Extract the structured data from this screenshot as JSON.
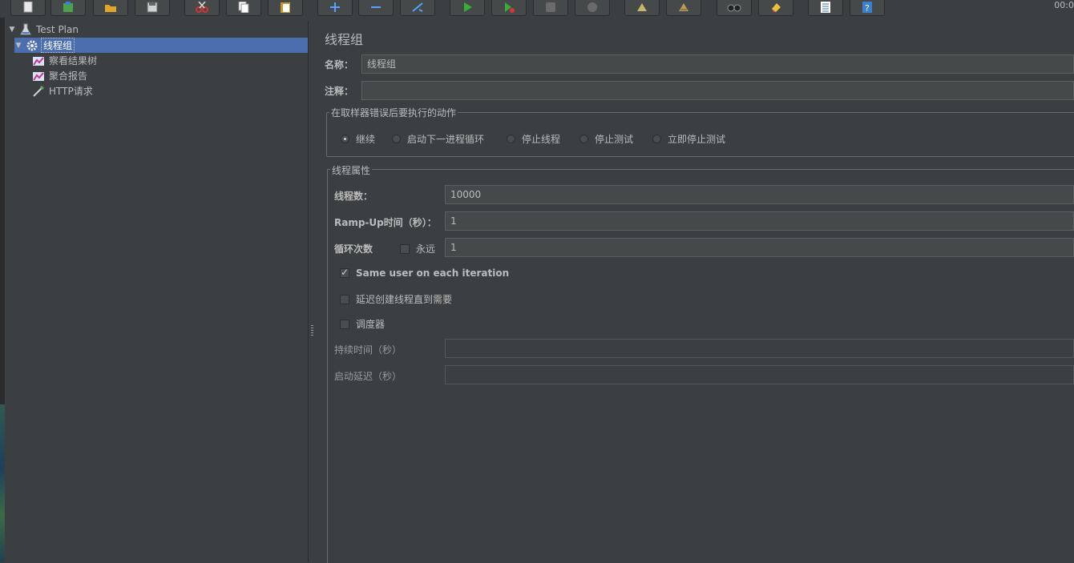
{
  "toolbar": {
    "clock": "00:0",
    "buttons": [
      {
        "name": "new-icon"
      },
      {
        "name": "templates-icon"
      },
      {
        "name": "open-icon"
      },
      {
        "name": "save-icon"
      },
      {
        "name": "cut-icon"
      },
      {
        "name": "copy-icon"
      },
      {
        "name": "paste-icon"
      },
      {
        "name": "expand-icon"
      },
      {
        "name": "collapse-icon"
      },
      {
        "name": "toggle-icon"
      },
      {
        "name": "start-icon"
      },
      {
        "name": "start-no-pause-icon"
      },
      {
        "name": "stop-icon"
      },
      {
        "name": "shutdown-icon"
      },
      {
        "name": "clear-icon"
      },
      {
        "name": "clear-all-icon"
      },
      {
        "name": "search-icon"
      },
      {
        "name": "reset-search-icon"
      },
      {
        "name": "function-helper-icon"
      },
      {
        "name": "help-icon"
      }
    ]
  },
  "tree": {
    "items": [
      {
        "label": "Test Plan",
        "icon": "test-plan-icon"
      },
      {
        "label": "线程组",
        "icon": "thread-group-icon",
        "selected": true
      },
      {
        "label": "察看结果树",
        "icon": "listener-icon"
      },
      {
        "label": "聚合报告",
        "icon": "listener-icon"
      },
      {
        "label": "HTTP请求",
        "icon": "sampler-icon"
      }
    ]
  },
  "editor": {
    "title": "线程组",
    "name_label": "名称：",
    "name_value": "线程组",
    "comment_label": "注释：",
    "comment_value": "",
    "error_action": {
      "title": "在取样器错误后要执行的动作",
      "options": [
        "继续",
        "启动下一进程循环",
        "停止线程",
        "停止测试",
        "立即停止测试"
      ],
      "selected": "继续"
    },
    "thread_props": {
      "title": "线程属性",
      "threads_label": "线程数：",
      "threads_value": "10000",
      "rampup_label": "Ramp-Up时间（秒）：",
      "rampup_value": "1",
      "loop_label": "循环次数",
      "forever_label": "永远",
      "forever_checked": false,
      "loop_value": "1",
      "same_user_label": "Same user on each iteration",
      "same_user_checked": true,
      "delay_label": "延迟创建线程直到需要",
      "delay_checked": false,
      "scheduler_label": "调度器",
      "scheduler_checked": false,
      "duration_label": "持续时间（秒）",
      "duration_value": "",
      "startup_delay_label": "启动延迟（秒）",
      "startup_delay_value": ""
    }
  },
  "colors": {
    "background": "#3c3f41",
    "selection": "#4b6eaf",
    "text": "#bbbbbb"
  }
}
